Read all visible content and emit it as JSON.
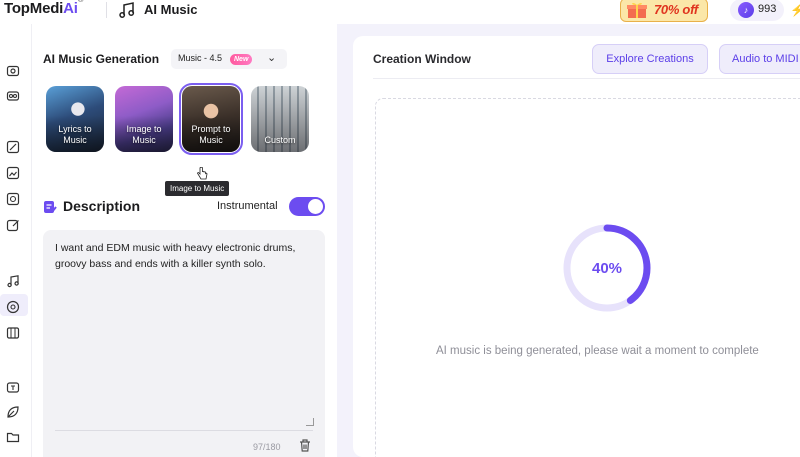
{
  "header": {
    "brand_main": "TopMedi",
    "brand_ai": "Ai",
    "brand_reg": "®",
    "page_title": "AI Music",
    "promo_text": "70% off",
    "credits": "993"
  },
  "panel": {
    "title": "AI Music Generation",
    "model": "Music - 4.5",
    "model_badge": "New",
    "modes": [
      {
        "label_1": "Lyrics to",
        "label_2": "Music"
      },
      {
        "label_1": "Image to",
        "label_2": "Music"
      },
      {
        "label_1": "Prompt to",
        "label_2": "Music"
      },
      {
        "label_1": "Custom",
        "label_2": ""
      }
    ],
    "selected_mode": "Prompt to Music",
    "tooltip": "Image to Music",
    "description_title": "Description",
    "instrumental_label": "Instrumental",
    "instrumental_on": true,
    "description_text": "I want and EDM music with heavy electronic drums, groovy bass and ends with a killer synth solo.",
    "char_count": "97/180"
  },
  "creation": {
    "title": "Creation Window",
    "explore_button": "Explore Creations",
    "midi_button": "Audio to MIDI",
    "progress_percent": 40,
    "progress_label": "40%",
    "status_message": "AI music is being generated, please wait a moment to complete"
  },
  "colors": {
    "accent": "#6c4cf0",
    "accent_light": "#efedfb",
    "promo_red": "#e0341f"
  }
}
